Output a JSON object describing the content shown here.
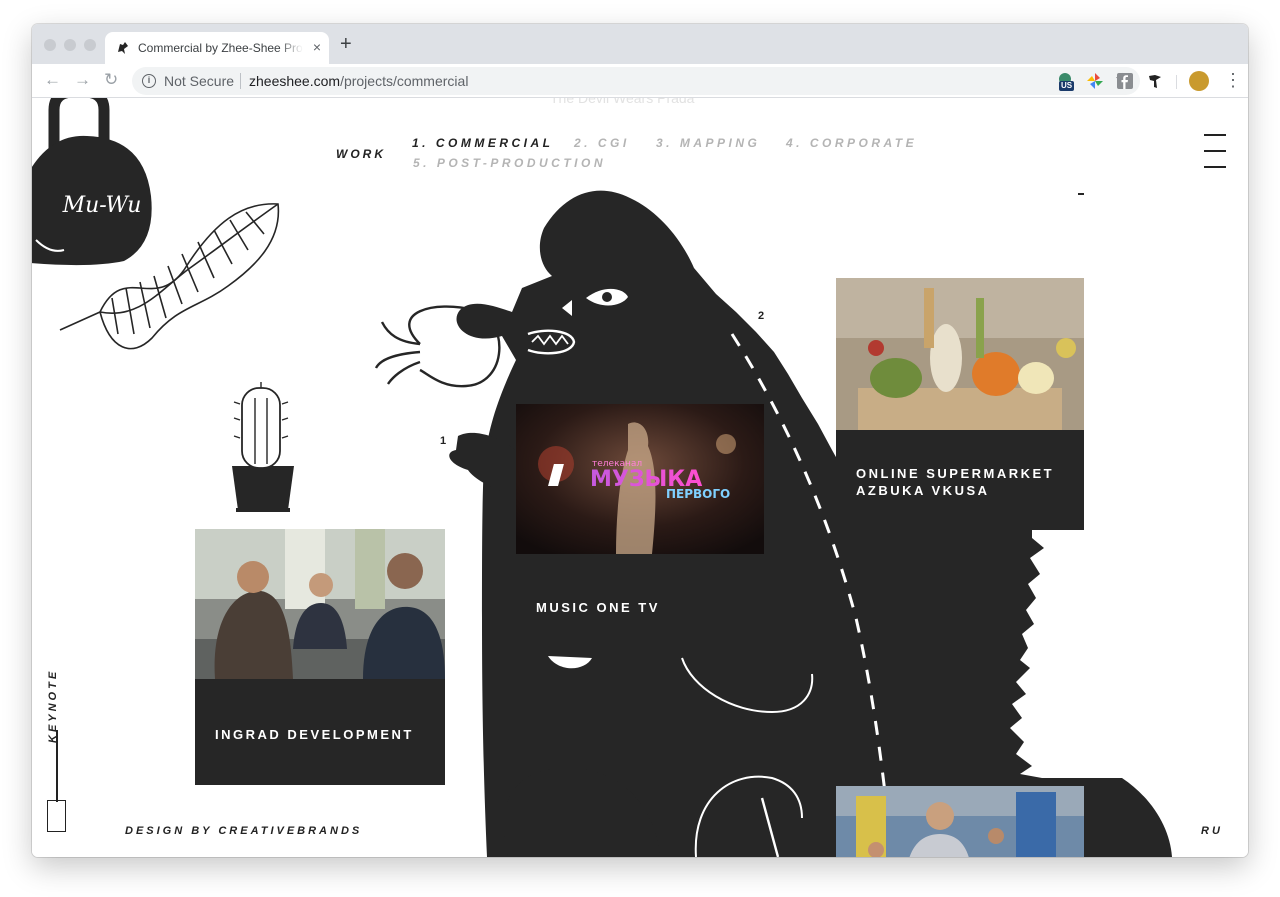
{
  "browser": {
    "tab_title": "Commercial by Zhee-Shee Pro",
    "tab_close": "×",
    "new_tab": "+",
    "security_label": "Not Secure",
    "url_host": "zheeshee.com",
    "url_path": "/projects/commercial",
    "extension_badge": "US",
    "icons": [
      "back-icon",
      "forward-icon",
      "reload-icon",
      "info-icon",
      "star-icon",
      "menu-icon"
    ]
  },
  "page": {
    "ghost_text": "The Devil Wears Prada",
    "logo_text": "Mu-Wu",
    "nav": {
      "work_label": "WORK",
      "items": [
        {
          "label": "1. COMMERCIAL",
          "active": true
        },
        {
          "label": "2. CGI",
          "active": false
        },
        {
          "label": "3. MAPPING",
          "active": false
        },
        {
          "label": "4. CORPORATE",
          "active": false
        },
        {
          "label": "5. POST-PRODUCTION",
          "active": false
        }
      ]
    },
    "projects": [
      {
        "label": "MUSIC ONE TV",
        "number": "1",
        "overlay": {
          "small": "телеканал",
          "big": "МУЗЫКА",
          "sub": "ПЕРВОГО",
          "logo": "1"
        }
      },
      {
        "label": "ONLINE SUPERMARKET\nAZBUKA VKUSA",
        "number": "2"
      },
      {
        "label": "INGRAD DEVELOPMENT"
      },
      {
        "label": ""
      }
    ],
    "footer": {
      "design_credit": "DESIGN BY CREATIVEBRANDS",
      "language": "RU",
      "keynote": "KEYNOTE"
    },
    "colors": {
      "ink": "#262626",
      "muted_nav": "#b4b4b4",
      "background": "#ffffff"
    }
  }
}
